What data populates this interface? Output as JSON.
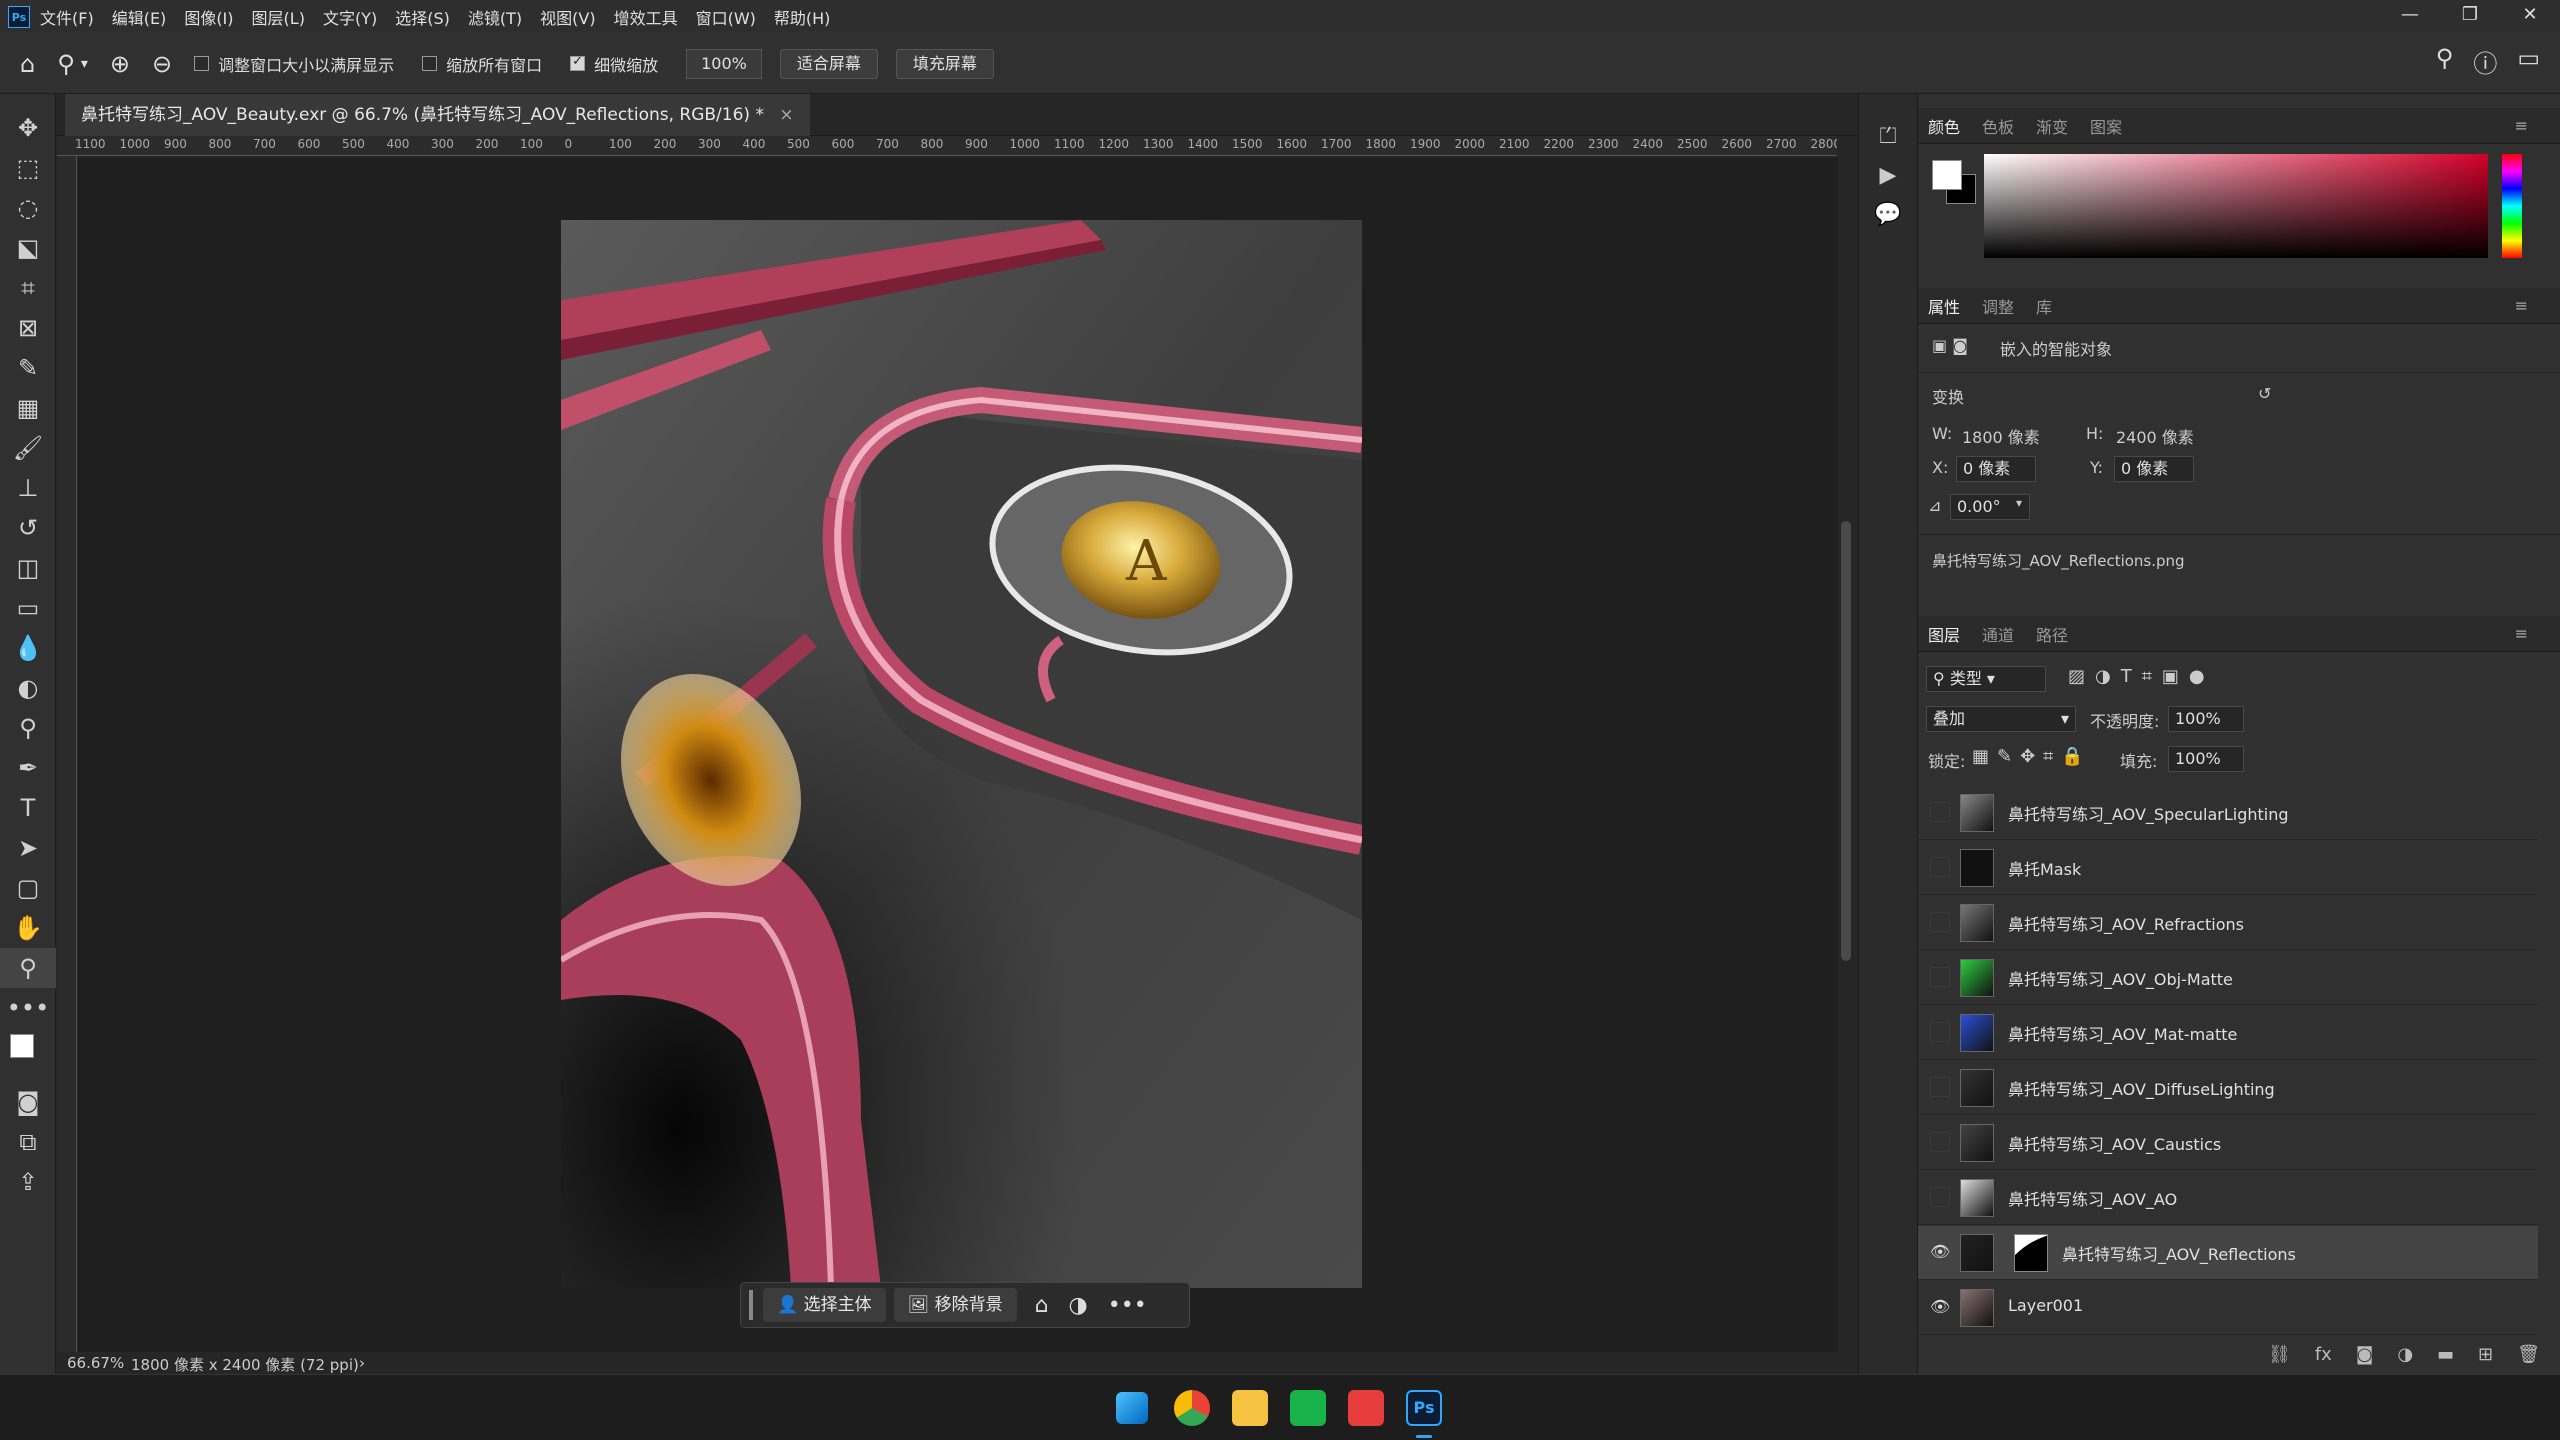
{
  "menubar": {
    "app_logo": "Ps",
    "items": [
      "文件(F)",
      "编辑(E)",
      "图像(I)",
      "图层(L)",
      "文字(Y)",
      "选择(S)",
      "滤镜(T)",
      "视图(V)",
      "增效工具",
      "窗口(W)",
      "帮助(H)"
    ],
    "window_controls": [
      "—",
      "❐",
      "✕"
    ]
  },
  "options_bar": {
    "check_resize": "调整窗口大小以满屏显示",
    "check_zoom_all": "缩放所有窗口",
    "check_scrubby": "细微缩放",
    "zoom_value": "100%",
    "fit_screen": "适合屏幕",
    "fill_screen": "填充屏幕"
  },
  "document": {
    "tab_title": "鼻托特写练习_AOV_Beauty.exr @ 66.7% (鼻托特写练习_AOV_Reflections, RGB/16) *",
    "tab_close": "×",
    "ruler_marks": [
      "1100",
      "1000",
      "900",
      "800",
      "700",
      "600",
      "500",
      "400",
      "300",
      "200",
      "100",
      "0",
      "100",
      "200",
      "300",
      "400",
      "500",
      "600",
      "700",
      "800",
      "900",
      "1000",
      "1100",
      "1200",
      "1300",
      "1400",
      "1500",
      "1600",
      "1700",
      "1800",
      "1900",
      "2000",
      "2100",
      "2200",
      "2300",
      "2400",
      "2500",
      "2600",
      "2700",
      "2800"
    ],
    "status_zoom": "66.67%",
    "status_info": "1800 像素 x 2400 像素 (72 ppi)",
    "status_arrow": "›"
  },
  "context_bar": {
    "select_subject": "选择主体",
    "remove_bg": "移除背景"
  },
  "color_panel": {
    "tabs": [
      "颜色",
      "色板",
      "渐变",
      "图案"
    ],
    "menu": "≡"
  },
  "properties_panel": {
    "tabs": [
      "属性",
      "调整",
      "库"
    ],
    "object_type": "嵌入的智能对象",
    "transform_label": "变换",
    "w_label": "W:",
    "w_value": "1800 像素",
    "h_label": "H:",
    "h_value": "2400 像素",
    "x_label": "X:",
    "x_value": "0 像素",
    "y_label": "Y:",
    "y_value": "0 像素",
    "angle_value": "0.00°",
    "linked_file": "鼻托特写练习_AOV_Reflections.png"
  },
  "layers_panel": {
    "tabs": [
      "图层",
      "通道",
      "路径"
    ],
    "filter_kind": "类型",
    "blend_mode": "叠加",
    "opacity_label": "不透明度:",
    "opacity_value": "100%",
    "lock_label": "锁定:",
    "fill_label": "填充:",
    "fill_value": "100%",
    "layers": [
      {
        "name": "鼻托特写练习_AOV_SpecularLighting",
        "visible": false
      },
      {
        "name": "鼻托Mask",
        "visible": false
      },
      {
        "name": "鼻托特写练习_AOV_Refractions",
        "visible": false
      },
      {
        "name": "鼻托特写练习_AOV_Obj-Matte",
        "visible": false
      },
      {
        "name": "鼻托特写练习_AOV_Mat-matte",
        "visible": false
      },
      {
        "name": "鼻托特写练习_AOV_DiffuseLighting",
        "visible": false
      },
      {
        "name": "鼻托特写练习_AOV_Caustics",
        "visible": false
      },
      {
        "name": "鼻托特写练习_AOV_AO",
        "visible": false
      },
      {
        "name": "鼻托特写练习_AOV_Reflections",
        "visible": true,
        "selected": true
      },
      {
        "name": "Layer001",
        "visible": true
      }
    ]
  },
  "colors": {
    "accent": "#31a8ff",
    "panel_bg": "#303030",
    "canvas_bg": "#1f1f1f"
  }
}
